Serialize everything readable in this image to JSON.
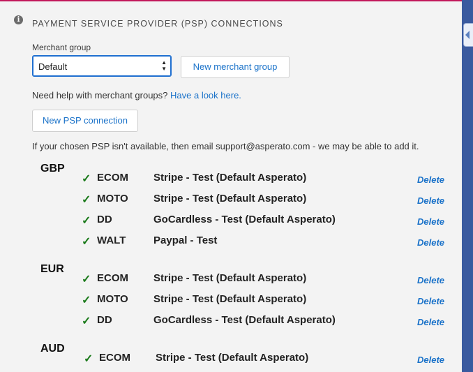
{
  "title": "PAYMENT SERVICE PROVIDER (PSP) CONNECTIONS",
  "merchant_group": {
    "label": "Merchant group",
    "selected": "Default"
  },
  "buttons": {
    "new_merchant_group": "New merchant group",
    "new_psp_connection": "New PSP connection"
  },
  "help": {
    "text": "Need help with merchant groups? ",
    "link": "Have a look here."
  },
  "email_note": "If your chosen PSP isn't available, then email support@asperato.com - we may be able to add it.",
  "currencies": [
    {
      "code": "GBP",
      "connections": [
        {
          "type": "ECOM",
          "psp": "Stripe - Test (Default Asperato)",
          "action": "Delete"
        },
        {
          "type": "MOTO",
          "psp": "Stripe - Test (Default Asperato)",
          "action": "Delete"
        },
        {
          "type": "DD",
          "psp": "GoCardless - Test (Default Asperato)",
          "action": "Delete"
        },
        {
          "type": "WALT",
          "psp": "Paypal - Test",
          "action": "Delete"
        }
      ]
    },
    {
      "code": "EUR",
      "connections": [
        {
          "type": "ECOM",
          "psp": "Stripe - Test (Default Asperato)",
          "action": "Delete"
        },
        {
          "type": "MOTO",
          "psp": "Stripe - Test (Default Asperato)",
          "action": "Delete"
        },
        {
          "type": "DD",
          "psp": "GoCardless - Test (Default Asperato)",
          "action": "Delete"
        }
      ]
    },
    {
      "code": "AUD",
      "connections": [
        {
          "type": "ECOM",
          "psp": "Stripe - Test (Default Asperato)",
          "action": "Delete"
        }
      ]
    }
  ],
  "colors": {
    "accent": "#1a72c9",
    "check": "#1a7a1a",
    "top_border": "#c2185b",
    "rail": "#3a5a9f"
  },
  "icons": {
    "info": "info-icon",
    "check": "check-icon"
  }
}
